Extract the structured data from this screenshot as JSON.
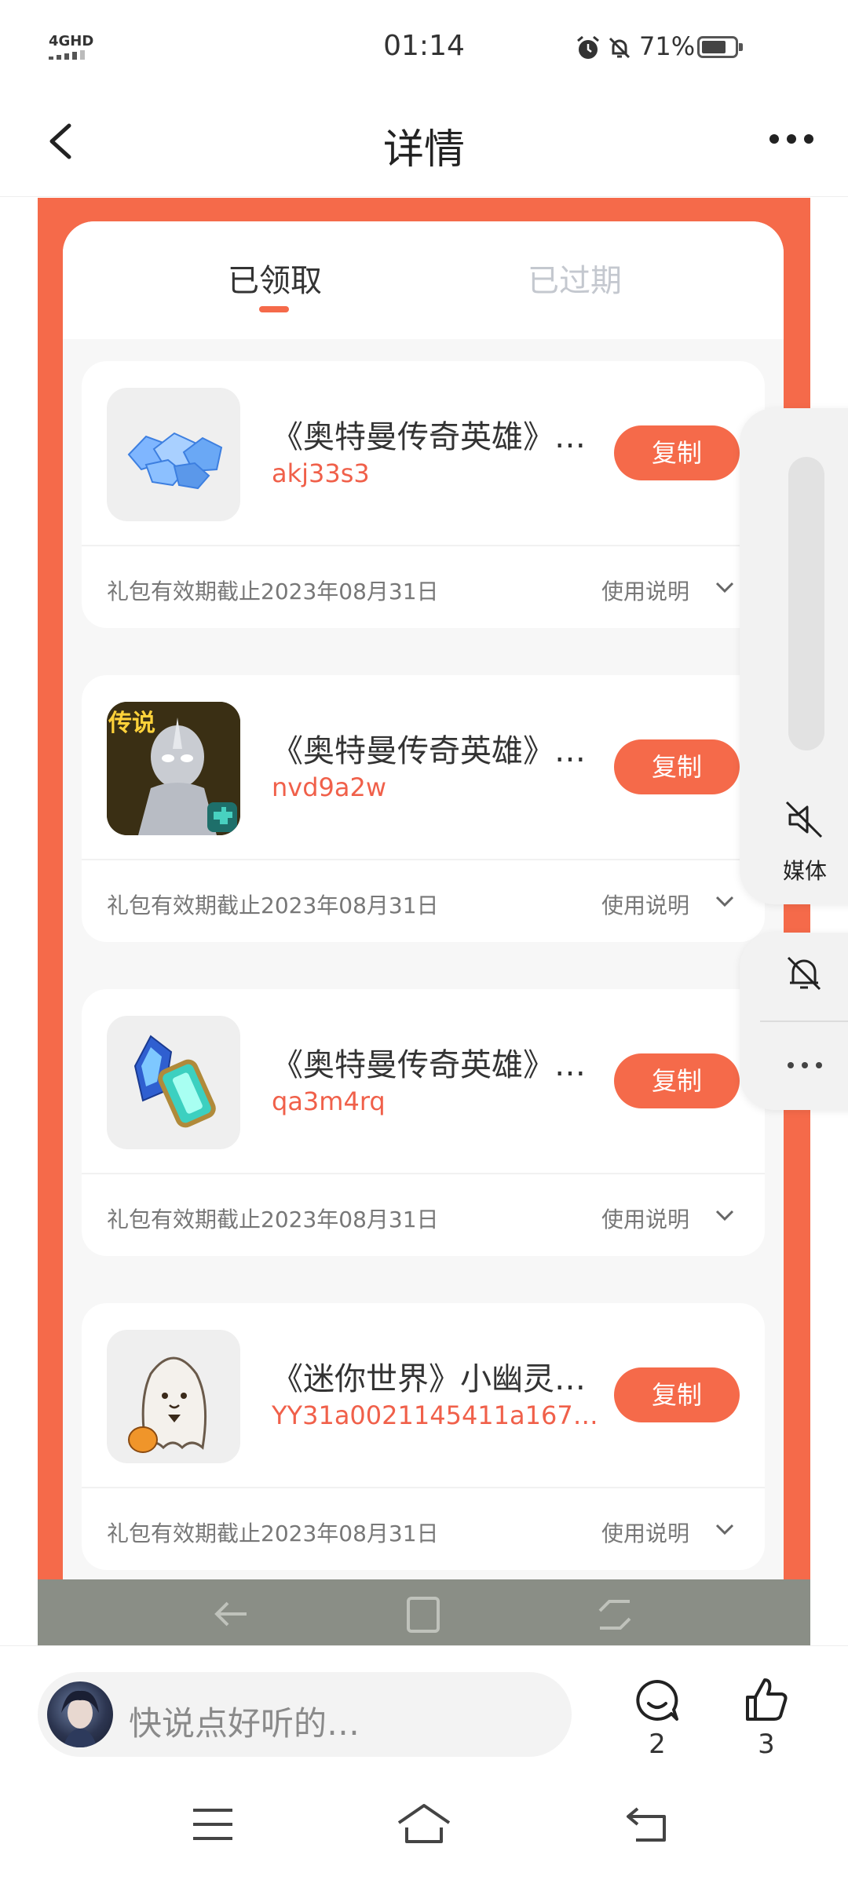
{
  "status_bar": {
    "network": "4GHD",
    "time": "01:14",
    "battery": "71%"
  },
  "header": {
    "title": "详情"
  },
  "tabs": {
    "active": "已领取",
    "inactive": "已过期"
  },
  "gifts": [
    {
      "name": "《奥特曼传奇英雄》…",
      "code": "akj33s3",
      "copy_label": "复制",
      "expiry": "礼包有效期截止2023年08月31日",
      "usage_label": "使用说明",
      "icon": "blue-gems-icon"
    },
    {
      "name": "《奥特曼传奇英雄》…",
      "code": "nvd9a2w",
      "copy_label": "复制",
      "expiry": "礼包有效期截止2023年08月31日",
      "usage_label": "使用说明",
      "icon": "ultraman-legend-icon",
      "icon_badge": "传说"
    },
    {
      "name": "《奥特曼传奇英雄》…",
      "code": "qa3m4rq",
      "copy_label": "复制",
      "expiry": "礼包有效期截止2023年08月31日",
      "usage_label": "使用说明",
      "icon": "crystal-scroll-icon"
    },
    {
      "name": "《迷你世界》小幽灵…",
      "code": "YY31a0021145411a167…",
      "copy_label": "复制",
      "expiry": "礼包有效期截止2023年08月31日",
      "usage_label": "使用说明",
      "icon": "little-ghost-icon"
    }
  ],
  "side_panel": {
    "media_label": "媒体"
  },
  "comment_bar": {
    "placeholder": "快说点好听的…",
    "comment_count": "2",
    "like_count": "3"
  },
  "colors": {
    "accent": "#f56a4a",
    "code_text": "#f0604a"
  }
}
